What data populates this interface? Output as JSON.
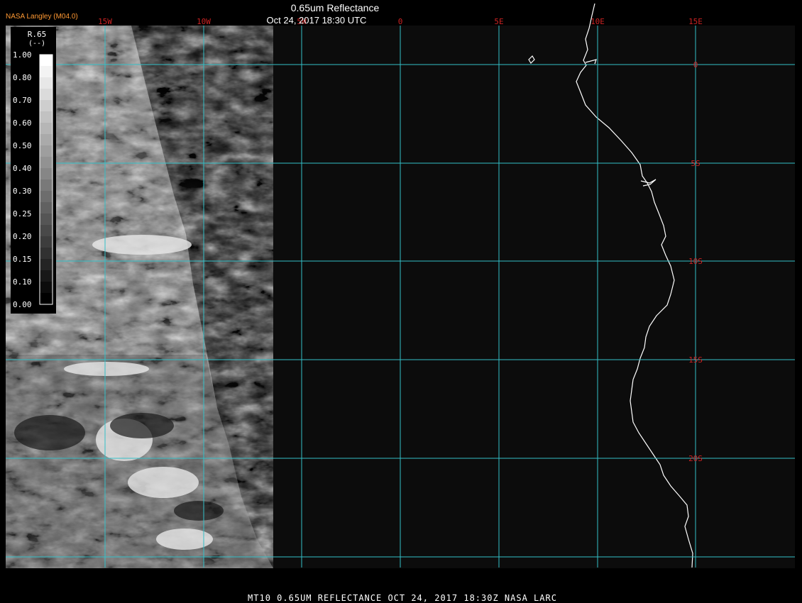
{
  "header": {
    "agency": "NASA Langley (M04.0)",
    "title": "0.65um Reflectance",
    "datetime": "Oct 24, 2017 18:30 UTC"
  },
  "footer": {
    "caption": "MT10  0.65UM REFLECTANCE   OCT 24, 2017 18:30Z   NASA LARC"
  },
  "lon_labels": [
    "15W",
    "10W",
    "5W",
    "0",
    "5E",
    "10E",
    "15E"
  ],
  "lat_labels": [
    "0",
    "5S",
    "10S",
    "15S",
    "20S"
  ],
  "legend": {
    "title": "R.65",
    "units": "(--)",
    "ticks": [
      "1.00",
      "0.80",
      "0.70",
      "0.60",
      "0.50",
      "0.40",
      "0.30",
      "0.25",
      "0.20",
      "0.15",
      "0.10",
      "0.00"
    ]
  },
  "colors": {
    "background": "#000000",
    "plot_area": "#0c0c0c",
    "grid": "#33c0c8",
    "grid_label": "#cc2222",
    "agency": "#ff9933",
    "coastline": "#ffffff",
    "text": "#ffffff"
  }
}
